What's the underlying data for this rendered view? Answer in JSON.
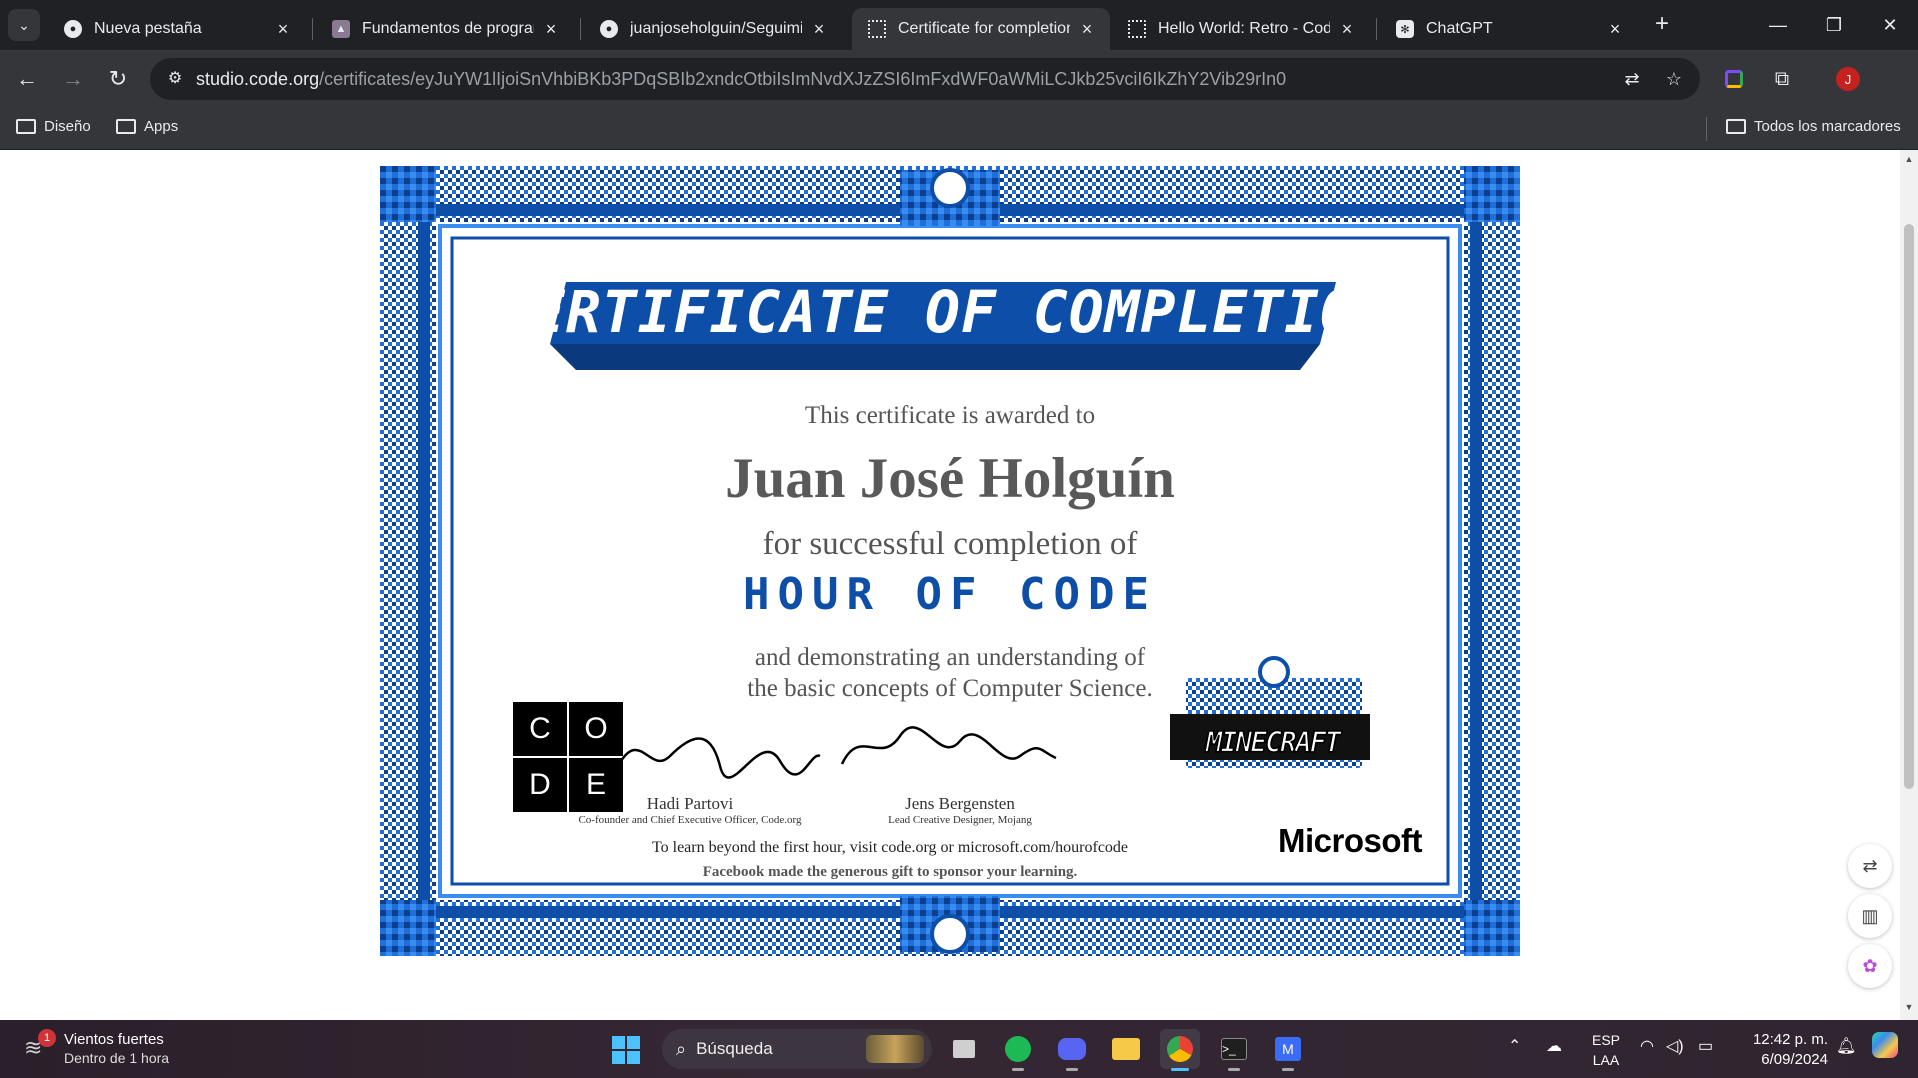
{
  "browser": {
    "tabs": [
      {
        "title": "Nueva pestaña",
        "active": false
      },
      {
        "title": "Fundamentos de programación",
        "active": false
      },
      {
        "title": "juanjoseholguin/Seguimiento",
        "active": false
      },
      {
        "title": "Certificate for completion of",
        "active": true
      },
      {
        "title": "Hello World: Retro - Code.org",
        "active": false
      },
      {
        "title": "ChatGPT",
        "active": false
      }
    ],
    "url_host": "studio.code.org",
    "url_path": "/certificates/eyJuYW1lIjoiSnVhbiBKb3PDqSBIb2xndcOtbiIsImNvdXJzZSI6ImFxdWF0aWMiLCJkb25vciI6IkZhY2Vib29rIn0",
    "avatar_letter": "J",
    "bookmarks": [
      {
        "label": "Diseño"
      },
      {
        "label": "Apps"
      }
    ],
    "all_bookmarks_label": "Todos los marcadores"
  },
  "certificate": {
    "heading": "CERTIFICATE OF COMPLETION",
    "awarded_to": "This certificate is awarded to",
    "recipient": "Juan José Holguín",
    "for_completion": "for successful completion of",
    "course": "HOUR OF CODE",
    "demonstrating_1": "and demonstrating an understanding of",
    "demonstrating_2": "the basic concepts of Computer Science.",
    "code_logo": [
      "C",
      "O",
      "D",
      "E"
    ],
    "signers": [
      {
        "name": "Hadi Partovi",
        "title": "Co-founder and Chief Executive Officer, Code.org"
      },
      {
        "name": "Jens Bergensten",
        "title": "Lead Creative Designer, Mojang"
      }
    ],
    "learn_more": "To learn beyond the first hour, visit code.org or microsoft.com/hourofcode",
    "sponsor": "Facebook made the generous gift to sponsor your learning.",
    "minecraft_logo": "MINECRAFT",
    "microsoft_logo": "Microsoft"
  },
  "taskbar": {
    "weather_title": "Vientos fuertes",
    "weather_sub": "Dentro de 1 hora",
    "weather_badge": "1",
    "search_placeholder": "Búsqueda",
    "lang_1": "ESP",
    "lang_2": "LAA",
    "time": "12:42 p. m.",
    "date": "6/09/2024"
  },
  "colors": {
    "frame_blue": "#0d4fa8",
    "chrome_dark": "#202124",
    "chrome_toolbar": "#35363a"
  }
}
